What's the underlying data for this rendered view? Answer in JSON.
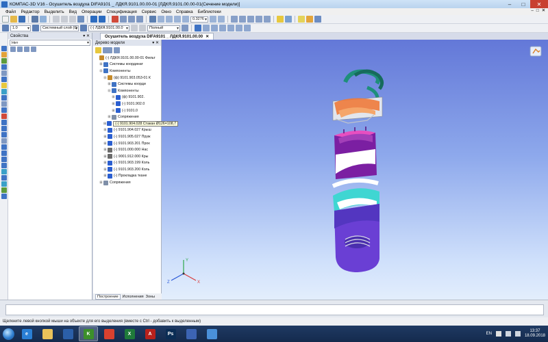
{
  "window": {
    "title": "КОМПАС-3D V16 - Осушитель воздуха DIFA9101 _ ЛДКЯ.9101.00.00-01 [ЛДКЯ.9101.00.00-01(Сечение модели)]",
    "minimize": "–",
    "maximize": "□",
    "close": "✕"
  },
  "menu": {
    "items": [
      "Файл",
      "Редактор",
      "Выделить",
      "Вид",
      "Операции",
      "Спецификация",
      "Сервис",
      "Окно",
      "Справка",
      "Библиотеки"
    ],
    "mdi": [
      "–",
      "□",
      "✕"
    ]
  },
  "toolbar": {
    "scale_value": "0.3276",
    "line_width_value": "1.0",
    "layer_value": "Системный слой (0)",
    "part_value": "(-) ЛДКЯ.9101.00.0",
    "display_mode_value": "Полный"
  },
  "document_tab": {
    "label": "Осушитель воздуха DIFA9101 _ ЛДКЯ.9101.00.00",
    "close": "✕"
  },
  "properties_panel": {
    "title": "Свойства",
    "pin": "▾ ✕",
    "combo_value": "Нет"
  },
  "tree_panel": {
    "title": "Дерево модели",
    "pin": "▾ ✕",
    "rows": [
      {
        "indent": 0,
        "expander": "",
        "icon": "assembly",
        "text": "(-) ЛДКЯ.9101.00.00-01 Фильт"
      },
      {
        "indent": 1,
        "expander": "⊞",
        "icon": "coords",
        "text": "Системы координат"
      },
      {
        "indent": 1,
        "expander": "⊟",
        "icon": "components",
        "text": "Компоненты"
      },
      {
        "indent": 2,
        "expander": "⊟",
        "icon": "assembly",
        "text": "(ф) 9101.903.053-01 К"
      },
      {
        "indent": 3,
        "expander": "⊞",
        "icon": "coords",
        "text": "Системы коорди"
      },
      {
        "indent": 3,
        "expander": "⊟",
        "icon": "components",
        "text": "Компоненты"
      },
      {
        "indent": 4,
        "expander": "⊞",
        "icon": "part",
        "text": "(ф) 9101.902."
      },
      {
        "indent": 4,
        "expander": "⊞",
        "icon": "part",
        "text": "(-) 9101.902.0"
      },
      {
        "indent": 4,
        "expander": "⊞",
        "icon": "part",
        "text": "(-) 9101.0"
      },
      {
        "indent": 3,
        "expander": "⊞",
        "icon": "mates",
        "text": "Сопряжения"
      },
      {
        "indent": 2,
        "expander": "⊞",
        "icon": "part",
        "text": "(-) 9101.904.028 Стакан Ø126=108,7",
        "tooltip": true
      },
      {
        "indent": 2,
        "expander": "⊞",
        "icon": "part",
        "text": "(-) 9101.904.027 Крыш"
      },
      {
        "indent": 2,
        "expander": "⊞",
        "icon": "part",
        "text": "(-) 9101.905.027 Пруж"
      },
      {
        "indent": 2,
        "expander": "⊞",
        "icon": "part",
        "text": "(-) 9101.903.201 Прок"
      },
      {
        "indent": 2,
        "expander": "⊞",
        "icon": "std",
        "text": "(-) 9101.000.000 Нас"
      },
      {
        "indent": 2,
        "expander": "⊞",
        "icon": "std",
        "text": "(-) 9001.912.000 Кры"
      },
      {
        "indent": 2,
        "expander": "⊞",
        "icon": "part",
        "text": "(-) 9101.903.199 Коль"
      },
      {
        "indent": 2,
        "expander": "⊞",
        "icon": "part",
        "text": "(-) 9101.903.200 Коль"
      },
      {
        "indent": 2,
        "expander": "⊞",
        "icon": "part",
        "text": "(-) Прокладка ткане"
      },
      {
        "indent": 1,
        "expander": "⊞",
        "icon": "mates",
        "text": "Сопряжения"
      }
    ],
    "bottom_tabs": [
      "Построение",
      "Исполнения",
      "Зоны"
    ]
  },
  "viewport": {
    "axis_labels": {
      "x": "X",
      "y": "Y",
      "z": "Z"
    }
  },
  "status_text": "Щелкните левой кнопкой мыши на объекте для его выделения (вместе с Ctrl - добавить к выделенным)",
  "taskbar": {
    "apps": [
      {
        "name": "ie",
        "label": "e",
        "color": "#2a7fd4"
      },
      {
        "name": "file-explorer",
        "label": "",
        "color": "#e9c25a"
      },
      {
        "name": "save-app",
        "label": "",
        "color": "#2b5fa8"
      },
      {
        "name": "kompas",
        "label": "K",
        "color": "#3c8f2a",
        "active": true
      },
      {
        "name": "chrome",
        "label": "",
        "color": "#d9412f"
      },
      {
        "name": "excel",
        "label": "X",
        "color": "#1f7a3a"
      },
      {
        "name": "acrobat",
        "label": "A",
        "color": "#b8211c"
      },
      {
        "name": "photoshop",
        "label": "Ps",
        "color": "#0b2d55"
      },
      {
        "name": "word-2",
        "label": "",
        "color": "#3c64b3"
      },
      {
        "name": "remote",
        "label": "",
        "color": "#4a90d9"
      }
    ],
    "language": "EN",
    "time": "13:37",
    "date": "18.09.2018"
  }
}
